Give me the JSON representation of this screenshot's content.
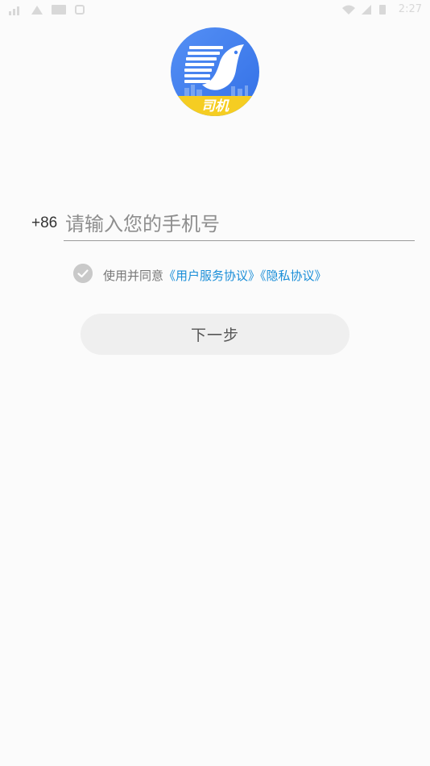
{
  "status_bar": {
    "time": "2:27",
    "left_icons": [
      "signal-icon",
      "notification-icon",
      "image-icon",
      "shield-icon"
    ],
    "right_icons": [
      "wifi-icon",
      "cellular-icon",
      "battery-icon"
    ]
  },
  "logo": {
    "badge_text": "司机",
    "colors": {
      "blue": "#3f7ef0",
      "yellow": "#f5cd22"
    }
  },
  "login": {
    "country_code": "+86",
    "phone_placeholder": "请输入您的手机号",
    "phone_value": "",
    "agreement_prefix": "使用并同意",
    "user_agreement_link": "《用户服务协议》",
    "privacy_link": "《隐私协议》",
    "agreement_checked": true,
    "next_label": "下一步"
  },
  "colors": {
    "link": "#1a8ed8",
    "background": "#fbfbfb",
    "button_bg": "#efefef"
  }
}
